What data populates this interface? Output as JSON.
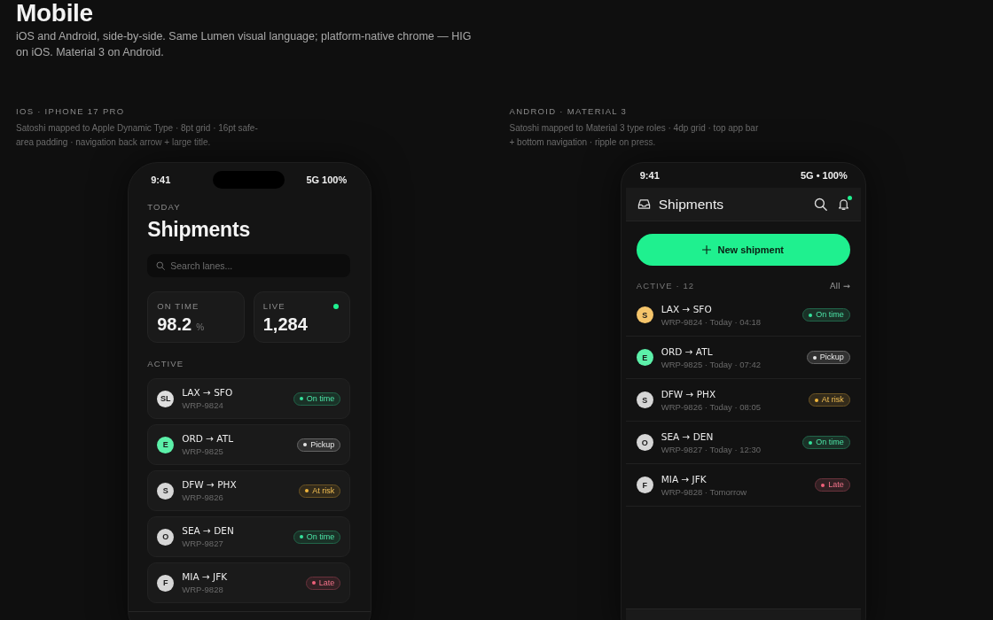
{
  "page": {
    "title": "Mobile",
    "description": "iOS and Android, side-by-side. Same Lumen visual language; platform-native chrome — HIG on iOS. Material 3 on Android."
  },
  "ios": {
    "section_label": "IOS · IPHONE 17 PRO",
    "caption": "Satoshi mapped to Apple Dynamic Type · 8pt grid · 16pt safe-area padding · navigation back arrow + large title.",
    "status_bar": {
      "time": "9:41",
      "signal": "5G 100%"
    },
    "eyebrow": "TODAY",
    "title": "Shipments",
    "search": {
      "placeholder": "Search lanes..."
    },
    "stats": [
      {
        "label": "ON TIME",
        "value": "98.2",
        "unit": "%",
        "live": false
      },
      {
        "label": "LIVE",
        "value": "1,284",
        "live": true
      }
    ],
    "section": "ACTIVE",
    "shipments": [
      {
        "avatar": {
          "initials": "SL",
          "color": "#dedede"
        },
        "route": "LAX → SFO",
        "code": "WRP-9824",
        "status": {
          "label": "On time",
          "color": "#34e29b"
        }
      },
      {
        "avatar": {
          "initials": "E",
          "color": "#5cf0a9"
        },
        "route": "ORD → ATL",
        "code": "WRP-9825",
        "status": {
          "label": "Pickup",
          "color": "#e6e6e6"
        }
      },
      {
        "avatar": {
          "initials": "S",
          "color": "#d6d6d6"
        },
        "route": "DFW → PHX",
        "code": "WRP-9826",
        "status": {
          "label": "At risk",
          "color": "#f2b73c"
        }
      },
      {
        "avatar": {
          "initials": "O",
          "color": "#d6d6d6"
        },
        "route": "SEA → DEN",
        "code": "WRP-9827",
        "status": {
          "label": "On time",
          "color": "#34e29b"
        }
      },
      {
        "avatar": {
          "initials": "F",
          "color": "#d6d6d6"
        },
        "route": "MIA → JFK",
        "code": "WRP-9828",
        "status": {
          "label": "Late",
          "color": "#f0607a"
        }
      }
    ]
  },
  "android": {
    "section_label": "ANDROID · MATERIAL 3",
    "caption": "Satoshi mapped to Material 3 type roles · 4dp grid · top app bar + bottom navigation · ripple on press.",
    "status_bar": {
      "time": "9:41",
      "signal": "5G • 100%"
    },
    "app_bar": {
      "title": "Shipments",
      "notification": true
    },
    "primary_button": "New shipment",
    "list_header": {
      "label": "ACTIVE · 12",
      "link": "All →"
    },
    "shipments": [
      {
        "avatar": {
          "initials": "S",
          "color": "#f5c56b"
        },
        "route": "LAX → SFO",
        "detail": "WRP-9824 · Today · 04:18",
        "status": {
          "label": "On time",
          "color": "#34e29b"
        }
      },
      {
        "avatar": {
          "initials": "E",
          "color": "#5cf0a9"
        },
        "route": "ORD → ATL",
        "detail": "WRP-9825 · Today · 07:42",
        "status": {
          "label": "Pickup",
          "color": "#e6e6e6"
        }
      },
      {
        "avatar": {
          "initials": "S",
          "color": "#d6d6d6"
        },
        "route": "DFW → PHX",
        "detail": "WRP-9826 · Today · 08:05",
        "status": {
          "label": "At risk",
          "color": "#f2b73c"
        }
      },
      {
        "avatar": {
          "initials": "O",
          "color": "#d6d6d6"
        },
        "route": "SEA → DEN",
        "detail": "WRP-9827 · Today · 12:30",
        "status": {
          "label": "On time",
          "color": "#34e29b"
        }
      },
      {
        "avatar": {
          "initials": "F",
          "color": "#d6d6d6"
        },
        "route": "MIA → JFK",
        "detail": "WRP-9828 · Tomorrow",
        "status": {
          "label": "Late",
          "color": "#f0607a"
        }
      }
    ]
  }
}
